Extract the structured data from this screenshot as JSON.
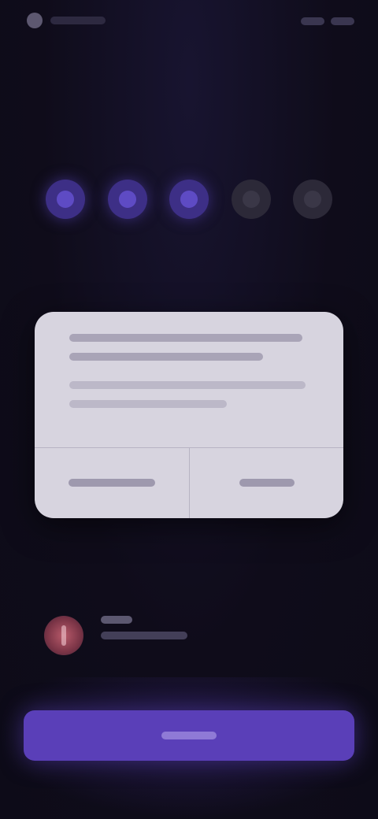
{
  "theme": {
    "background": "#0f0c1a",
    "accent": "#5a3fb8",
    "dialog_background": "#d7d4df",
    "warning_color": "#7a3446"
  },
  "status_bar": {
    "icon": "app-icon"
  },
  "header": {
    "title": ""
  },
  "steps": {
    "total": 5,
    "completed": 3,
    "items": [
      {
        "state": "active"
      },
      {
        "state": "active"
      },
      {
        "state": "active"
      },
      {
        "state": "inactive"
      },
      {
        "state": "inactive"
      }
    ]
  },
  "instruction": {
    "text": ""
  },
  "dialog": {
    "message": "",
    "secondary_label": "",
    "primary_label": ""
  },
  "notice": {
    "icon": "warning-icon",
    "title": "",
    "subtitle": ""
  },
  "footer": {
    "button_label": ""
  }
}
